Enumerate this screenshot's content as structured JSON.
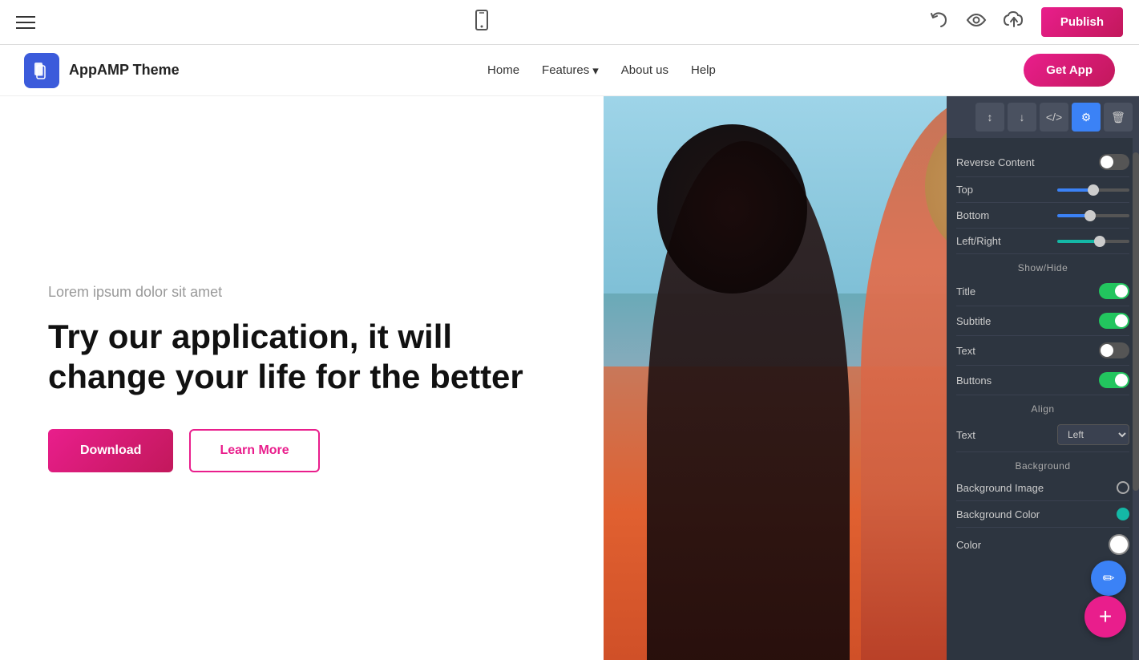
{
  "toolbar": {
    "publish_label": "Publish"
  },
  "site_navbar": {
    "logo_name": "AppAMP Theme",
    "nav_items": [
      "Home",
      "Features",
      "About us",
      "Help"
    ],
    "get_app_label": "Get App"
  },
  "hero": {
    "subtitle": "Lorem ipsum dolor sit amet",
    "title": "Try our application, it will change your life for the better",
    "btn_download": "Download",
    "btn_learnmore": "Learn More"
  },
  "panel": {
    "reverse_content_label": "Reverse Content",
    "top_label": "Top",
    "bottom_label": "Bottom",
    "leftright_label": "Left/Right",
    "show_hide_label": "Show/Hide",
    "title_label": "Title",
    "subtitle_label": "Subtitle",
    "text_label": "Text",
    "buttons_label": "Buttons",
    "align_label": "Align",
    "text_align_label": "Text",
    "text_align_value": "Left",
    "background_label": "Background",
    "bg_image_label": "Background Image",
    "bg_color_label": "Background Color",
    "color_label": "Color",
    "tools": {
      "sort": "↕",
      "download": "↓",
      "code": "</>",
      "settings": "⚙",
      "trash": "🗑"
    }
  }
}
